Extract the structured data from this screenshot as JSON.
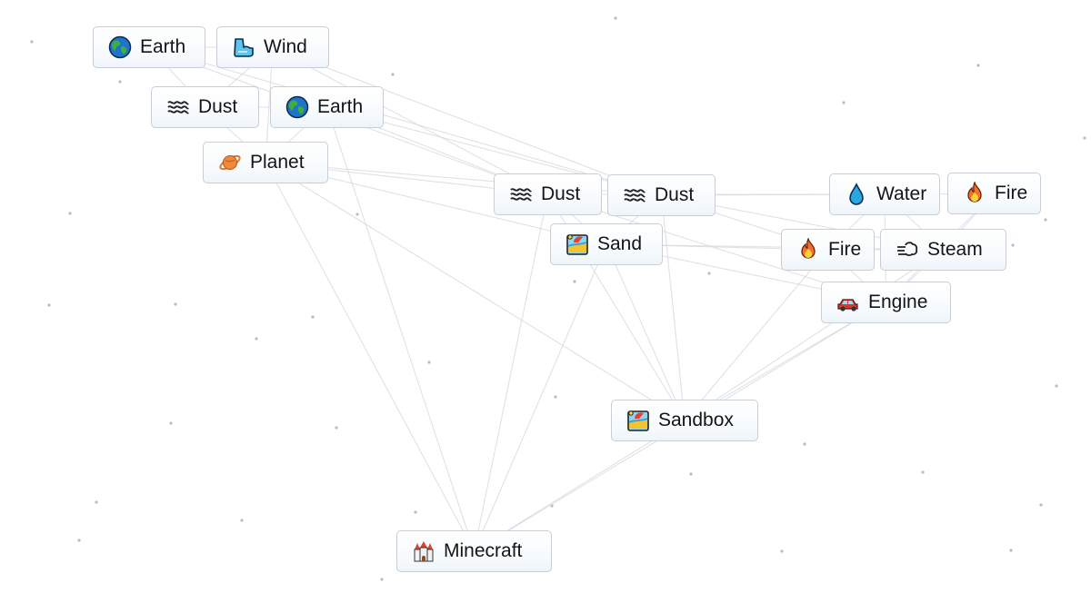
{
  "app": "Infinite Craft",
  "elements": [
    {
      "id": "earth-1",
      "label": "Earth",
      "icon": "globe-icon"
    },
    {
      "id": "wind",
      "label": "Wind",
      "icon": "wind-icon"
    },
    {
      "id": "dust-1",
      "label": "Dust",
      "icon": "dust-waves-icon"
    },
    {
      "id": "earth-2",
      "label": "Earth",
      "icon": "globe-icon"
    },
    {
      "id": "planet",
      "label": "Planet",
      "icon": "planet-icon"
    },
    {
      "id": "dust-2",
      "label": "Dust",
      "icon": "dust-waves-icon"
    },
    {
      "id": "dust-3",
      "label": "Dust",
      "icon": "dust-waves-icon"
    },
    {
      "id": "sand",
      "label": "Sand",
      "icon": "beach-icon"
    },
    {
      "id": "water",
      "label": "Water",
      "icon": "droplet-icon"
    },
    {
      "id": "fire-1",
      "label": "Fire",
      "icon": "fire-icon"
    },
    {
      "id": "fire-2",
      "label": "Fire",
      "icon": "fire-icon"
    },
    {
      "id": "steam",
      "label": "Steam",
      "icon": "steam-icon"
    },
    {
      "id": "engine",
      "label": "Engine",
      "icon": "car-icon"
    },
    {
      "id": "sandbox",
      "label": "Sandbox",
      "icon": "beach-icon"
    },
    {
      "id": "minecraft",
      "label": "Minecraft",
      "icon": "castle-icon"
    }
  ],
  "connections": [
    [
      "earth-1",
      "wind"
    ],
    [
      "earth-1",
      "dust-1"
    ],
    [
      "wind",
      "dust-1"
    ],
    [
      "wind",
      "planet"
    ],
    [
      "dust-1",
      "earth-2"
    ],
    [
      "dust-1",
      "planet"
    ],
    [
      "earth-2",
      "planet"
    ],
    [
      "earth-1",
      "dust-2"
    ],
    [
      "wind",
      "dust-2"
    ],
    [
      "earth-2",
      "dust-2"
    ],
    [
      "planet",
      "dust-2"
    ],
    [
      "earth-2",
      "dust-3"
    ],
    [
      "wind",
      "dust-3"
    ],
    [
      "planet",
      "dust-3"
    ],
    [
      "earth-1",
      "dust-3"
    ],
    [
      "planet",
      "sand"
    ],
    [
      "dust-2",
      "sand"
    ],
    [
      "dust-3",
      "sand"
    ],
    [
      "dust-3",
      "water"
    ],
    [
      "dust-2",
      "water"
    ],
    [
      "water",
      "fire-1"
    ],
    [
      "water",
      "steam"
    ],
    [
      "fire-2",
      "steam"
    ],
    [
      "water",
      "fire-2"
    ],
    [
      "fire-1",
      "steam"
    ],
    [
      "sand",
      "fire-2"
    ],
    [
      "sand",
      "steam"
    ],
    [
      "dust-3",
      "fire-2"
    ],
    [
      "dust-3",
      "steam"
    ],
    [
      "fire-2",
      "engine"
    ],
    [
      "steam",
      "engine"
    ],
    [
      "water",
      "engine"
    ],
    [
      "fire-1",
      "engine"
    ],
    [
      "sand",
      "engine"
    ],
    [
      "dust-2",
      "engine"
    ],
    [
      "sand",
      "sandbox"
    ],
    [
      "engine",
      "sandbox"
    ],
    [
      "fire-2",
      "sandbox"
    ],
    [
      "steam",
      "sandbox"
    ],
    [
      "dust-2",
      "sandbox"
    ],
    [
      "dust-3",
      "sandbox"
    ],
    [
      "planet",
      "sandbox"
    ],
    [
      "planet",
      "minecraft"
    ],
    [
      "earth-2",
      "minecraft"
    ],
    [
      "sand",
      "minecraft"
    ],
    [
      "sandbox",
      "minecraft"
    ],
    [
      "engine",
      "minecraft"
    ],
    [
      "dust-2",
      "minecraft"
    ]
  ]
}
